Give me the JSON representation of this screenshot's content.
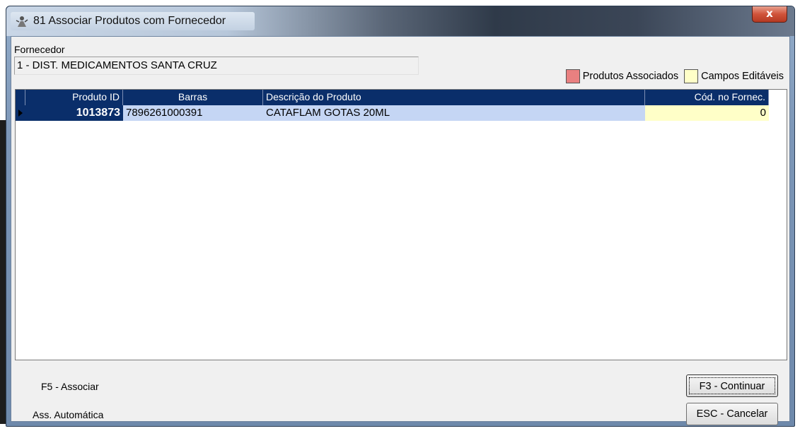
{
  "window": {
    "title": "81 Associar Produtos com Fornecedor",
    "close_label": "x"
  },
  "fornecedor": {
    "label": "Fornecedor",
    "value": "1 - DIST. MEDICAMENTOS SANTA CRUZ"
  },
  "legend": {
    "items": [
      {
        "label": "Produtos Associados",
        "color": "#e98080"
      },
      {
        "label": "Campos Editáveis",
        "color": "#ffffc8"
      }
    ]
  },
  "grid": {
    "columns": [
      "Produto ID",
      "Barras",
      "Descrição do Produto",
      "Cód. no Fornec."
    ],
    "rows": [
      {
        "produto_id": "1013873",
        "barras": "7896261000391",
        "descricao": "CATAFLAM GOTAS 20ML",
        "cod_fornec": "0"
      }
    ],
    "colors": {
      "header_bg": "#0a2e6a",
      "selected_row_bg": "#c5d6f4",
      "editable_bg": "#ffffc8"
    }
  },
  "actions": {
    "associar": "F5 - Associar",
    "automatica": "Ass. Automática",
    "continuar": "F3 - Continuar",
    "cancelar": "ESC - Cancelar"
  }
}
